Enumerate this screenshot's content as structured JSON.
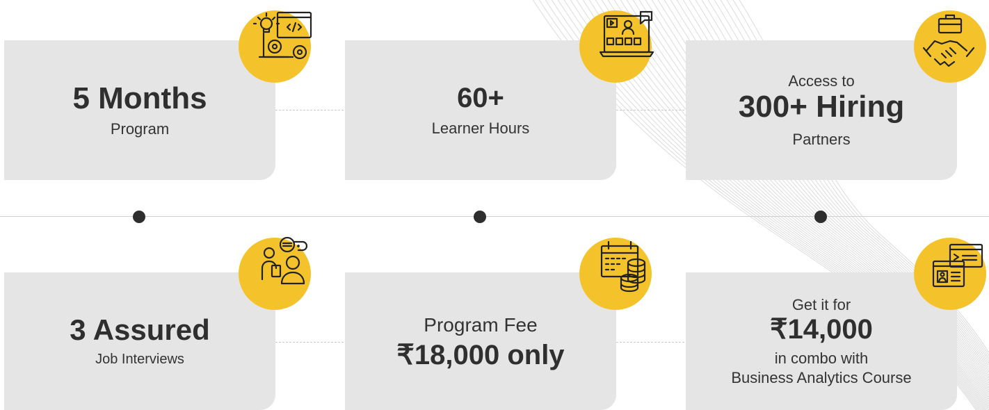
{
  "colors": {
    "card_bg": "#e5e5e5",
    "badge": "#f4c32c",
    "text": "#2f2f2f",
    "dot": "#2e2e2e"
  },
  "cards": [
    {
      "icon": "idea-code-gears-icon",
      "title": "5 Months",
      "subtitle": "Program"
    },
    {
      "icon": "online-video-learning-icon",
      "title": "60+",
      "subtitle": "Learner Hours"
    },
    {
      "icon": "handshake-briefcase-icon",
      "prefix": "Access to",
      "title": "300+ Hiring",
      "subtitle": "Partners"
    },
    {
      "icon": "interview-chat-icon",
      "title": "3 Assured",
      "subtitle": "Job Interviews"
    },
    {
      "icon": "calendar-coins-icon",
      "prefix": "Program Fee",
      "title": "₹18,000 only"
    },
    {
      "icon": "code-browser-icon",
      "prefix": "Get it for",
      "title": "₹14,000",
      "subtitle": "in combo with",
      "subtitle2": "Business Analytics Course"
    }
  ]
}
